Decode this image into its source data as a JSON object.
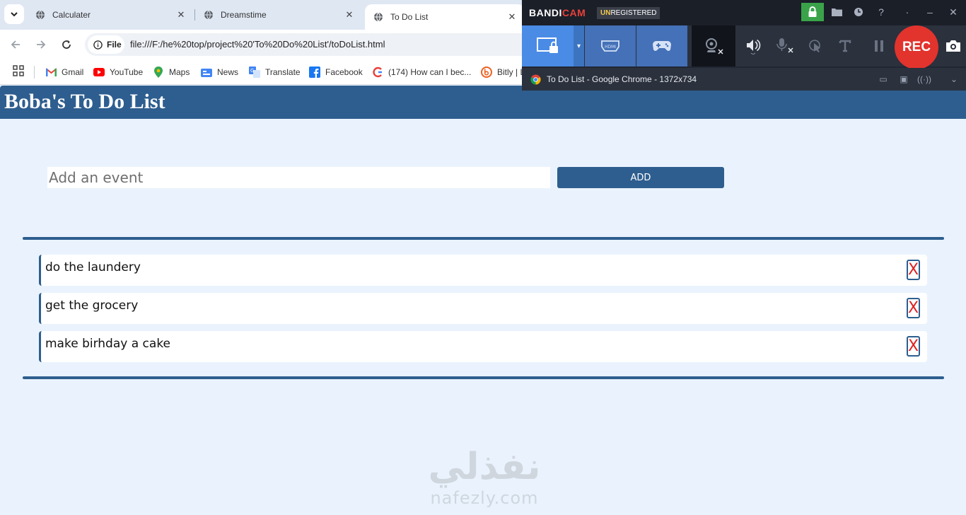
{
  "browser": {
    "tabs": [
      {
        "title": "Calculater",
        "active": false
      },
      {
        "title": "Dreamstime",
        "active": false
      },
      {
        "title": "To Do List",
        "active": true
      }
    ],
    "site_chip": "File",
    "url": "file:///F:/he%20top/project%20'To%20Do%20List'/toDoList.html",
    "bookmarks": [
      {
        "label": "Gmail",
        "icon": "gmail-icon"
      },
      {
        "label": "YouTube",
        "icon": "youtube-icon"
      },
      {
        "label": "Maps",
        "icon": "maps-icon"
      },
      {
        "label": "News",
        "icon": "news-icon"
      },
      {
        "label": "Translate",
        "icon": "translate-icon"
      },
      {
        "label": "Facebook",
        "icon": "facebook-icon"
      },
      {
        "label": "(174) How can I bec...",
        "icon": "quora-icon"
      },
      {
        "label": "Bitly | L",
        "icon": "bitly-icon"
      }
    ]
  },
  "page": {
    "title": "Boba's To Do List",
    "input_placeholder": "Add an event",
    "add_label": "ADD",
    "todos": [
      {
        "text": "do the laundery",
        "delete_label": "X"
      },
      {
        "text": "get the grocery",
        "delete_label": "X"
      },
      {
        "text": "make birhday a cake",
        "delete_label": "X"
      }
    ],
    "watermark_arabic": "نفذلي",
    "watermark_latin": "nafezly.com"
  },
  "bandicam": {
    "logo_a": "BANDI",
    "logo_b": "CAM",
    "unreg_a": "UN",
    "unreg_b": "REGISTERED",
    "rec_label": "REC",
    "status_text": "To Do List - Google Chrome - 1372x734"
  },
  "colors": {
    "page_bg": "#eaf3fd",
    "accent": "#2e5e8f",
    "delete_red": "#e02020",
    "rec_red": "#e2332d"
  }
}
